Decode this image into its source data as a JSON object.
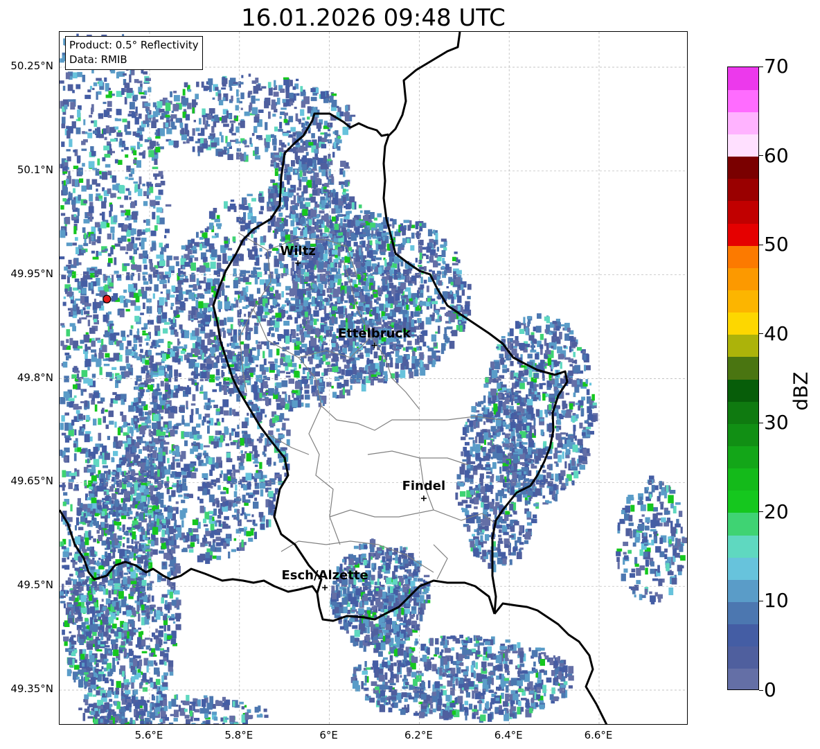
{
  "title": "16.01.2026 09:48 UTC",
  "info": {
    "product": "Product: 0.5° Reflectivity",
    "source": "Data: RMIB"
  },
  "axes": {
    "lat_ticks": [
      "50.25°N",
      "50.1°N",
      "49.95°N",
      "49.8°N",
      "49.65°N",
      "49.5°N",
      "49.35°N"
    ],
    "lat_values": [
      50.25,
      50.1,
      49.95,
      49.8,
      49.65,
      49.5,
      49.35
    ],
    "lon_ticks": [
      "5.6°E",
      "5.8°E",
      "6°E",
      "6.2°E",
      "6.4°E",
      "6.6°E"
    ],
    "lon_values": [
      5.6,
      5.8,
      6.0,
      6.2,
      6.4,
      6.6
    ],
    "lon_range": [
      5.4,
      6.8
    ],
    "lat_range": [
      49.3,
      50.3
    ],
    "grid": true
  },
  "radar_site": {
    "lon": 5.505,
    "lat": 49.915,
    "color": "#e41a1c"
  },
  "cities": [
    {
      "name": "Wiltz",
      "lon": 5.93,
      "lat": 49.967
    },
    {
      "name": "Ettelbruck",
      "lon": 6.1,
      "lat": 49.848
    },
    {
      "name": "Findel",
      "lon": 6.21,
      "lat": 49.627
    },
    {
      "name": "Esch/Alzette",
      "lon": 5.99,
      "lat": 49.498
    }
  ],
  "colorbar": {
    "label": "dBZ",
    "ticks": [
      "0",
      "10",
      "20",
      "30",
      "40",
      "50",
      "60",
      "70"
    ],
    "tick_values": [
      0,
      10,
      20,
      30,
      40,
      50,
      60,
      70
    ],
    "range": [
      0,
      70
    ],
    "colors": [
      "#646fa6",
      "#4f5f9e",
      "#445da4",
      "#4c77b0",
      "#5a9cc8",
      "#67c3dc",
      "#5fd8c0",
      "#3fd373",
      "#15c71e",
      "#14ba1a",
      "#13a618",
      "#118f14",
      "#0f7a10",
      "#075d09",
      "#4a7511",
      "#acb30a",
      "#fdd700",
      "#fcb500",
      "#fc9900",
      "#fc7a00",
      "#e50000",
      "#c10000",
      "#9a0000",
      "#7a0000",
      "#ffe0ff",
      "#ffb3ff",
      "#ff6cff",
      "#ec39ec"
    ]
  }
}
